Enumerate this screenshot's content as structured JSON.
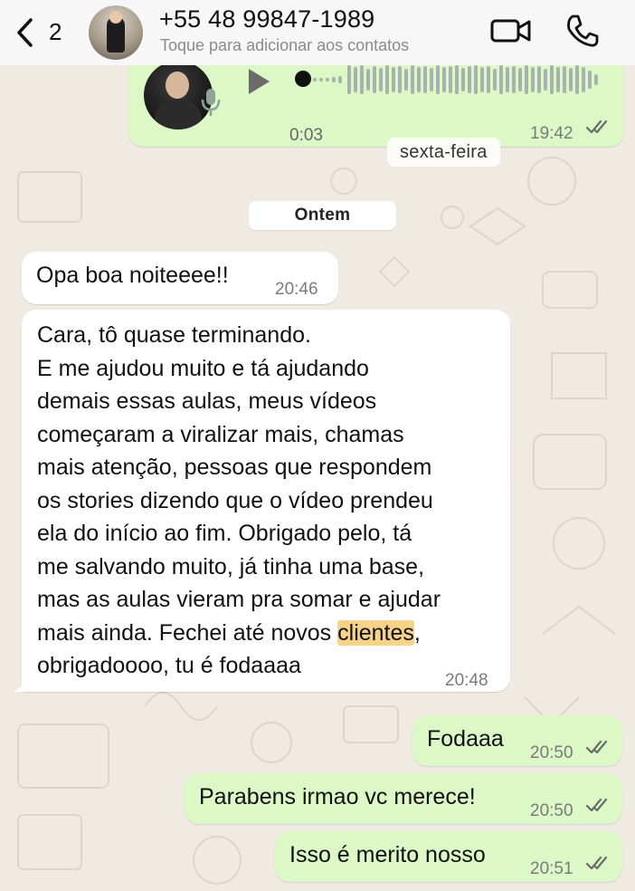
{
  "header": {
    "back_count": "2",
    "contact_name": "+55 48 99847-1989",
    "contact_subtitle": "Toque para adicionar aos contatos"
  },
  "voice_message": {
    "duration": "0:03",
    "time": "19:42",
    "day_overlay": "sexta-feira"
  },
  "date_chip": "Ontem",
  "messages": [
    {
      "direction": "in",
      "text": "Opa boa noiteeee!!",
      "time": "20:46"
    },
    {
      "direction": "in",
      "lines": [
        "Cara, tô quase terminando.",
        "E me ajudou muito e tá ajudando",
        "demais essas aulas, meus vídeos",
        "começaram a viralizar mais, chamas",
        "mais atenção, pessoas que respondem",
        "os stories dizendo que o vídeo prendeu",
        "ela do início ao fim. Obrigado pelo, tá",
        "me salvando muito, já tinha uma base,",
        "mas as aulas vieram pra somar e ajudar"
      ],
      "line10_before": "mais ainda. Fechei até novos ",
      "line10_highlight": "clientes",
      "line10_after": ",",
      "last_line": "obrigadoooo, tu é fodaaaa",
      "time": "20:48"
    },
    {
      "direction": "out",
      "text": "Fodaaa",
      "time": "20:50"
    },
    {
      "direction": "out",
      "text": "Parabens irmao vc merece!",
      "time": "20:50"
    },
    {
      "direction": "out",
      "text": "Isso é merito nosso",
      "time": "20:51"
    }
  ],
  "colors": {
    "outgoing_bubble": "#dcf8c6",
    "incoming_bubble": "#ffffff",
    "wallpaper": "#efeae2",
    "highlight": "#f7d38a",
    "read_ticks": "#6b6b6b"
  }
}
